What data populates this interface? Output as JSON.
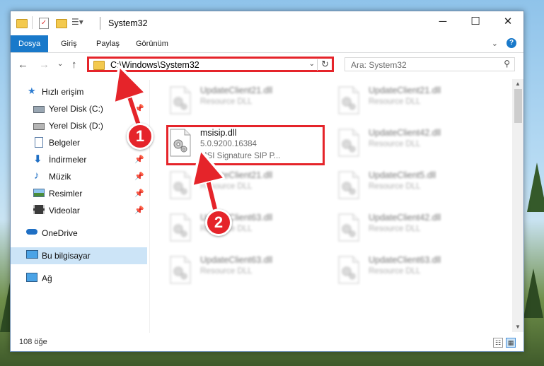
{
  "window": {
    "title": "System32"
  },
  "ribbon": {
    "tabs": [
      {
        "label": "Dosya",
        "active": true
      },
      {
        "label": "Giriş",
        "active": false
      },
      {
        "label": "Paylaş",
        "active": false
      },
      {
        "label": "Görünüm",
        "active": false
      }
    ]
  },
  "address": {
    "path": "C:\\Windows\\System32"
  },
  "search": {
    "placeholder": "Ara: System32"
  },
  "sidebar": {
    "items": [
      {
        "label": "Hızlı erişim",
        "icon": "star-icon",
        "pinned": false
      },
      {
        "label": "Yerel Disk (C:)",
        "icon": "drive-icon",
        "pinned": true
      },
      {
        "label": "Yerel Disk (D:)",
        "icon": "drive-icon",
        "pinned": false
      },
      {
        "label": "Belgeler",
        "icon": "document-icon",
        "pinned": true
      },
      {
        "label": "İndirmeler",
        "icon": "download-icon",
        "pinned": true
      },
      {
        "label": "Müzik",
        "icon": "music-icon",
        "pinned": true
      },
      {
        "label": "Resimler",
        "icon": "picture-icon",
        "pinned": true
      },
      {
        "label": "Videolar",
        "icon": "video-icon",
        "pinned": true
      },
      {
        "label": "OneDrive",
        "icon": "cloud-icon",
        "pinned": false
      },
      {
        "label": "Bu bilgisayar",
        "icon": "computer-icon",
        "pinned": false
      },
      {
        "label": "Ağ",
        "icon": "network-icon",
        "pinned": false
      }
    ]
  },
  "files": [
    {
      "name": "UpdateClient21.dll",
      "line2": "Resource DLL",
      "line3": ""
    },
    {
      "name": "UpdateClient21.dll",
      "line2": "Resource DLL",
      "line3": ""
    },
    {
      "name": "msisip.dll",
      "line2": "5.0.9200.16384",
      "line3": "MSI Signature SIP P..."
    },
    {
      "name": "UpdateClient42.dll",
      "line2": "Resource DLL",
      "line3": ""
    },
    {
      "name": "UpdateClient21.dll",
      "line2": "Resource DLL",
      "line3": ""
    },
    {
      "name": "UpdateClient5.dll",
      "line2": "Resource DLL",
      "line3": ""
    },
    {
      "name": "UpdateClient63.dll",
      "line2": "Resource DLL",
      "line3": ""
    },
    {
      "name": "UpdateClient42.dll",
      "line2": "Resource DLL",
      "line3": ""
    },
    {
      "name": "UpdateClient63.dll",
      "line2": "Resource DLL",
      "line3": ""
    },
    {
      "name": "UpdateClient63.dll",
      "line2": "Resource DLL",
      "line3": ""
    }
  ],
  "status": {
    "count": "108 öğe"
  },
  "annotations": {
    "step1": "1",
    "step2": "2"
  },
  "colors": {
    "accent": "#1979ca",
    "highlight": "#e5242a",
    "selected": "#cce4f7"
  }
}
